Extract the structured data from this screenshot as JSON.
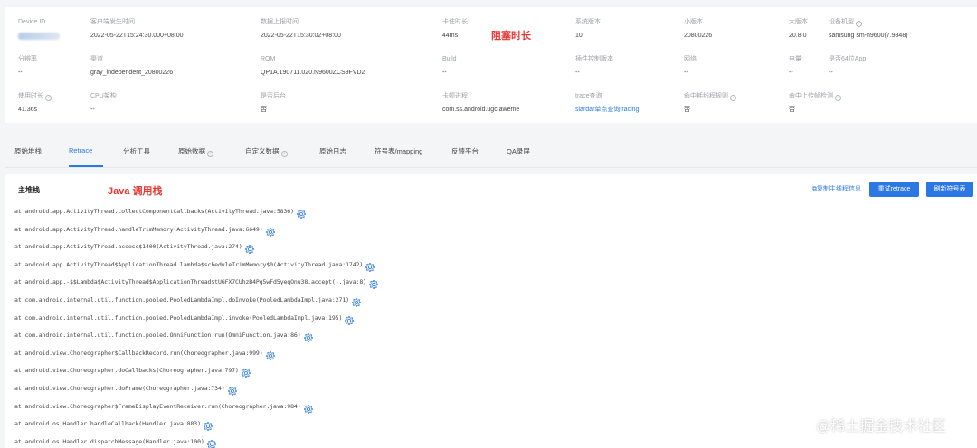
{
  "info": {
    "device_id": {
      "label": "Device ID"
    },
    "client_time": {
      "label": "客户端发生时间",
      "value": "2022-05-22T15:24:30.000+08:00"
    },
    "report_time": {
      "label": "数据上报时间",
      "value": "2022-05-22T15:30:02+08:00"
    },
    "stall_duration": {
      "label": "卡住时长",
      "value": "44ms"
    },
    "os_version": {
      "label": "系统版本",
      "value": "10"
    },
    "minor_version": {
      "label": "小版本",
      "value": "20800226"
    },
    "major_version": {
      "label": "大版本",
      "value": "20.8.0"
    },
    "device_model": {
      "label": "设备机型",
      "value": "samsung sm-n9600(7.9848)"
    },
    "resolution": {
      "label": "分辨率",
      "value": "--"
    },
    "channel": {
      "label": "渠道",
      "value": "gray_independent_20800226"
    },
    "rom": {
      "label": "ROM",
      "value": "QP1A.190711.020.N9600ZCS9FVD2"
    },
    "build": {
      "label": "Build",
      "value": "--"
    },
    "plugin_version": {
      "label": "插件控制版本",
      "value": "--"
    },
    "network": {
      "label": "网络",
      "value": "--"
    },
    "battery": {
      "label": "电量",
      "value": "--"
    },
    "is_64bit": {
      "label": "是否64位App",
      "value": "--"
    },
    "usage_duration": {
      "label": "使用时长",
      "value": "41.36s"
    },
    "cpu_arch": {
      "label": "CPU架构",
      "value": "--"
    },
    "is_background": {
      "label": "是否后台",
      "value": "否"
    },
    "stall_process": {
      "label": "卡顿进程",
      "value": "com.ss.android.ugc.aweme"
    },
    "trace_query": {
      "label": "trace查询",
      "value": "slardar单点查询tracing"
    },
    "hit_main_rule": {
      "label": "命中耗线程规则",
      "value": "否"
    },
    "hit_main_check": {
      "label": "命中上传帧检测",
      "value": "否"
    }
  },
  "annotations": {
    "stall_label": "阻塞时长",
    "stack_label": "Java 调用栈"
  },
  "tabs": [
    "原始堆栈",
    "Retrace",
    "分析工具",
    "原始数据",
    "自定义数据",
    "原始日志",
    "符号表/mapping",
    "反馈平台",
    "QA录屏"
  ],
  "stack": {
    "title": "主堆栈",
    "copy_label": "复制主线程信息",
    "retry_button": "重试retrace",
    "refresh_button": "刷新符号表",
    "frames": [
      "at android.app.ActivityThread.collectComponentCallbacks(ActivityThread.java:5836)",
      "at android.app.ActivityThread.handleTrimMemory(ActivityThread.java:6649)",
      "at android.app.ActivityThread.access$1400(ActivityThread.java:274)",
      "at android.app.ActivityThread$ApplicationThread.lambda$scheduleTrimMemory$0(ActivityThread.java:1742)",
      "at android.app.-$$Lambda$ActivityThread$ApplicationThread$tUGFX7CUhzB4Pg5wFd5yeqOnu38.accept(-.java:8)",
      "at com.android.internal.util.function.pooled.PooledLambdaImpl.doInvoke(PooledLambdaImpl.java:271)",
      "at com.android.internal.util.function.pooled.PooledLambdaImpl.invoke(PooledLambdaImpl.java:195)",
      "at com.android.internal.util.function.pooled.OmniFunction.run(OmniFunction.java:86)",
      "at android.view.Choreographer$CallbackRecord.run(Choreographer.java:999)",
      "at android.view.Choreographer.doCallbacks(Choreographer.java:797)",
      "at android.view.Choreographer.doFrame(Choreographer.java:734)",
      "at android.view.Choreographer$FrameDisplayEventReceiver.run(Choreographer.java:984)",
      "at android.os.Handler.handleCallback(Handler.java:883)",
      "at android.os.Handler.dispatchMessage(Handler.java:100)"
    ]
  },
  "watermark": "@稀土掘金技术社区",
  "colors": {
    "accent": "#2b78e4",
    "annotation": "#e53935"
  }
}
